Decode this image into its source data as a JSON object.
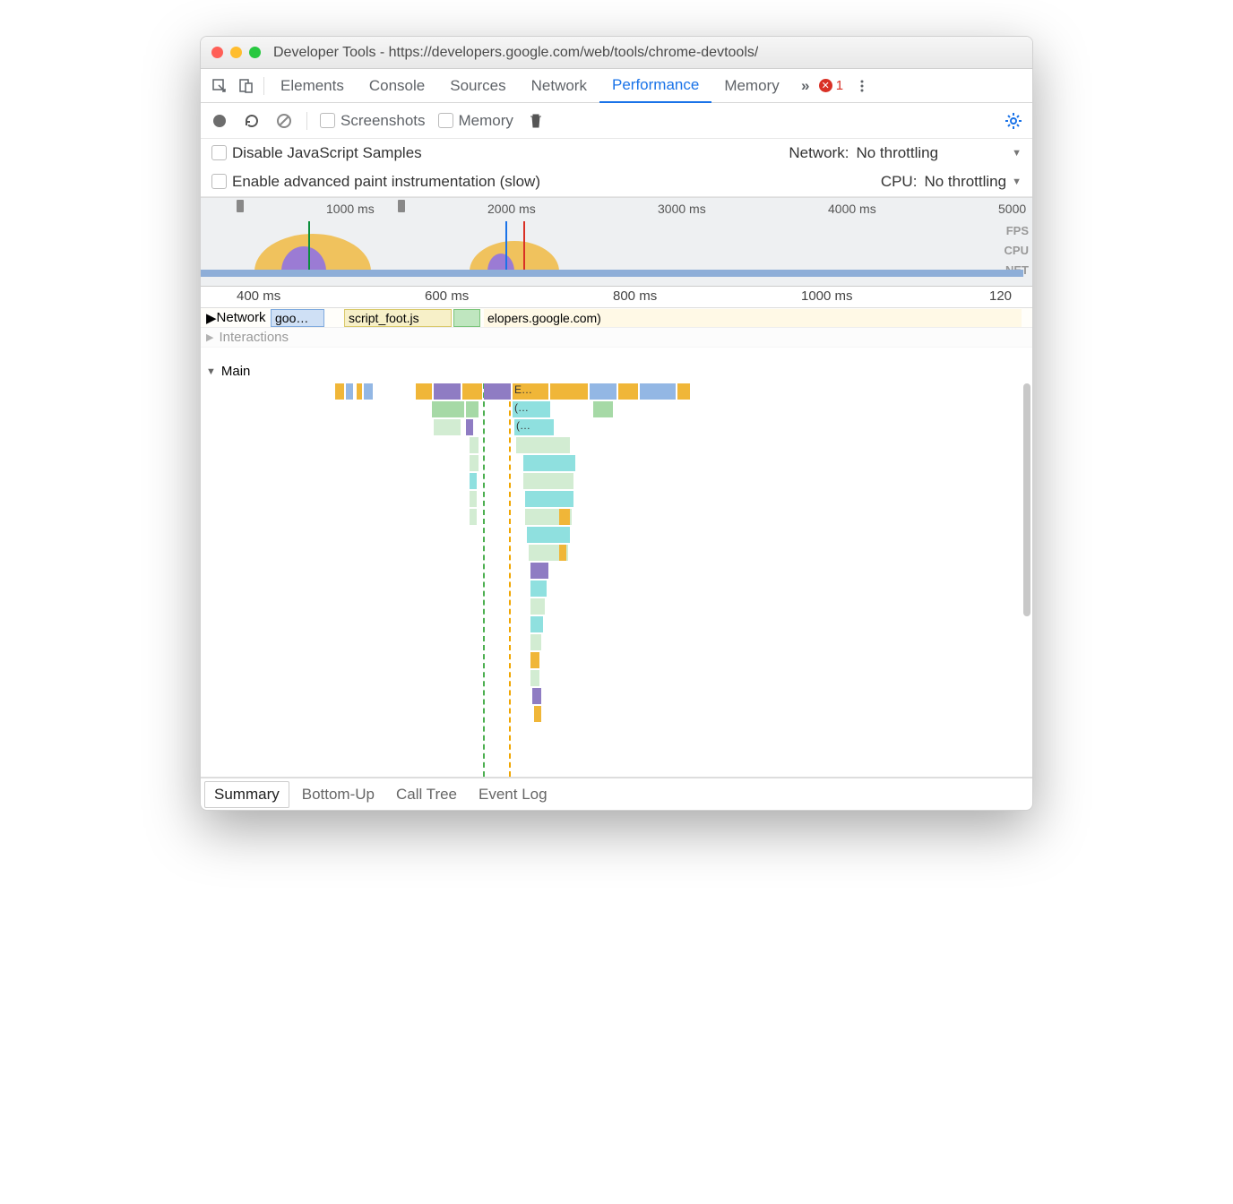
{
  "window": {
    "title": "Developer Tools - https://developers.google.com/web/tools/chrome-devtools/"
  },
  "tabs": {
    "items": [
      "Elements",
      "Console",
      "Sources",
      "Network",
      "Performance",
      "Memory"
    ],
    "active": "Performance",
    "overflow": "»",
    "errors": "1"
  },
  "toolbar": {
    "screenshots_label": "Screenshots",
    "memory_label": "Memory"
  },
  "options": {
    "disable_js": "Disable JavaScript Samples",
    "enable_paint": "Enable advanced paint instrumentation (slow)",
    "network_label": "Network:",
    "network_value": "No throttling",
    "cpu_label": "CPU:",
    "cpu_value": "No throttling"
  },
  "overview": {
    "ticks": [
      "1000 ms",
      "2000 ms",
      "3000 ms",
      "4000 ms",
      "5000"
    ],
    "lanes": [
      "FPS",
      "CPU",
      "NET"
    ]
  },
  "ruler": {
    "ticks": [
      "400 ms",
      "600 ms",
      "800 ms",
      "1000 ms",
      "120"
    ]
  },
  "tracks": {
    "network": {
      "label": "Network",
      "items": [
        "goo…",
        "script_foot.js",
        "elopers.google.com)"
      ]
    },
    "interactions": "Interactions",
    "main": "Main",
    "flame_labels": [
      "E…",
      "(…",
      "(…"
    ]
  },
  "bottom_tabs": {
    "items": [
      "Summary",
      "Bottom-Up",
      "Call Tree",
      "Event Log"
    ],
    "active": "Summary"
  }
}
